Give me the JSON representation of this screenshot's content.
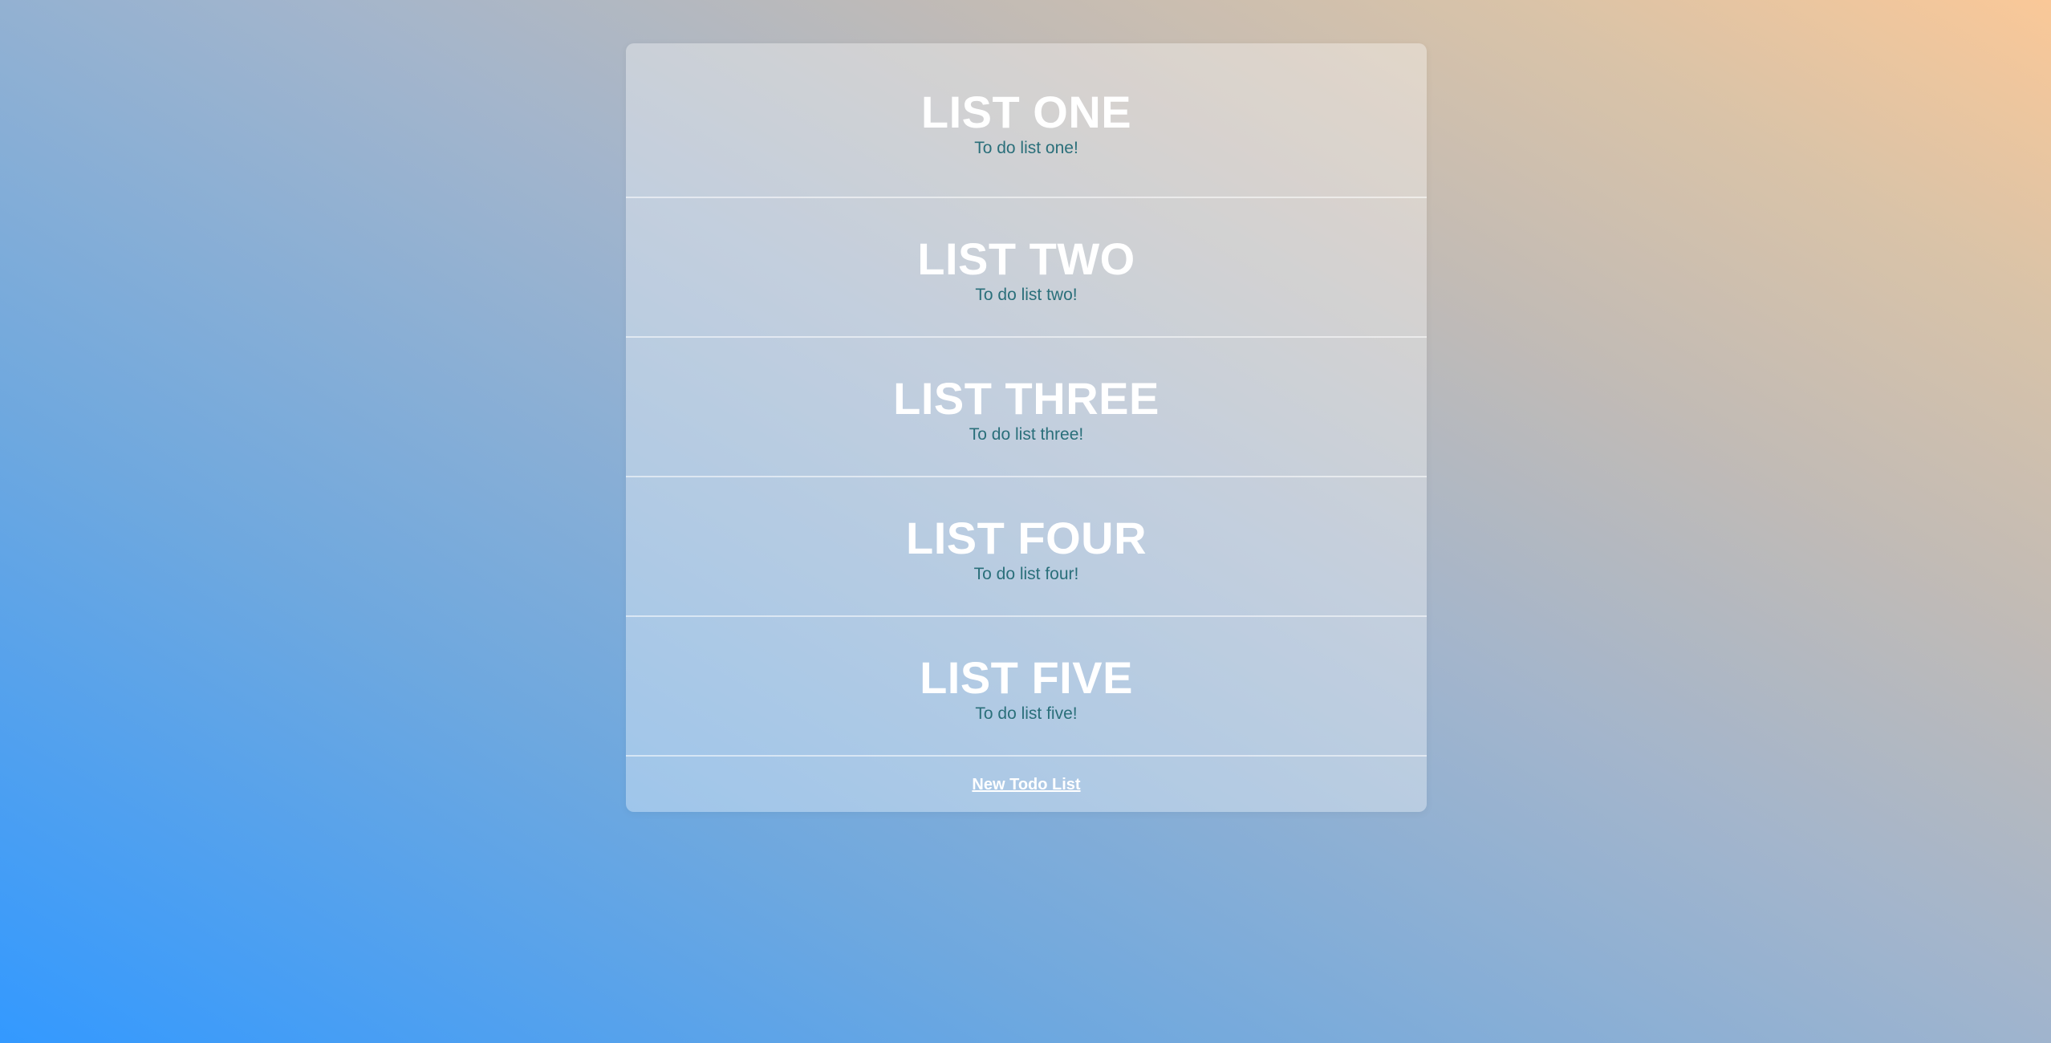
{
  "lists": [
    {
      "title": "LIST ONE",
      "description": "To do list one!"
    },
    {
      "title": "LIST TWO",
      "description": "To do list two!"
    },
    {
      "title": "LIST THREE",
      "description": "To do list three!"
    },
    {
      "title": "LIST FOUR",
      "description": "To do list four!"
    },
    {
      "title": "LIST FIVE",
      "description": "To do list five!"
    }
  ],
  "footer": {
    "new_list_label": "New Todo List"
  },
  "colors": {
    "title": "#ffffff",
    "description": "#2a6f7a",
    "gradient_start": "#3399ff",
    "gradient_end": "#fac898"
  }
}
